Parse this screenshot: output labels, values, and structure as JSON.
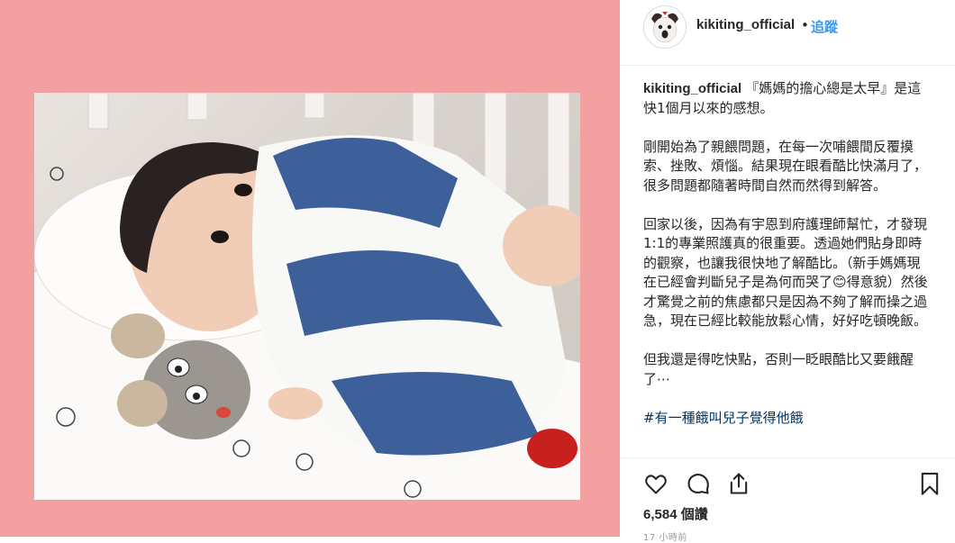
{
  "post": {
    "username": "kikiting_official",
    "dot": "•",
    "follow_label": "追蹤",
    "caption": {
      "username": "kikiting_official",
      "p1": "『媽媽的擔心總是太早』是這快1個月以來的感想。",
      "p2": "剛開始為了親餵問題，在每一次哺餵間反覆摸索、挫敗、煩惱。結果現在眼看酷比快滿月了，很多問題都隨著時間自然而然得到解答。",
      "p3": "回家以後，因為有宇恩到府護理師幫忙，才發現1:1的專業照護真的很重要。透過她們貼身即時的觀察，也讓我很快地了解酷比。（新手媽媽現在已經會判斷兒子是為何而哭了😊得意貌）然後才驚覺之前的焦慮都只是因為不夠了解而操之過急，現在已經比較能放鬆心情，好好吃頓晚飯。",
      "p4": "但我還是得吃快點，否則一眨眼酷比又要餓醒了⋯",
      "hashtag": "#有一種餓叫兒子覺得他餓"
    },
    "likes": "6,584 個讚",
    "time_ago": "17 小時前"
  },
  "icons": {
    "like": "heart-icon",
    "comment": "comment-icon",
    "share": "share-icon",
    "save": "bookmark-icon"
  },
  "colors": {
    "pink_background": "#f3a0a0",
    "follow_blue": "#3897f0",
    "hashtag": "#003569"
  }
}
